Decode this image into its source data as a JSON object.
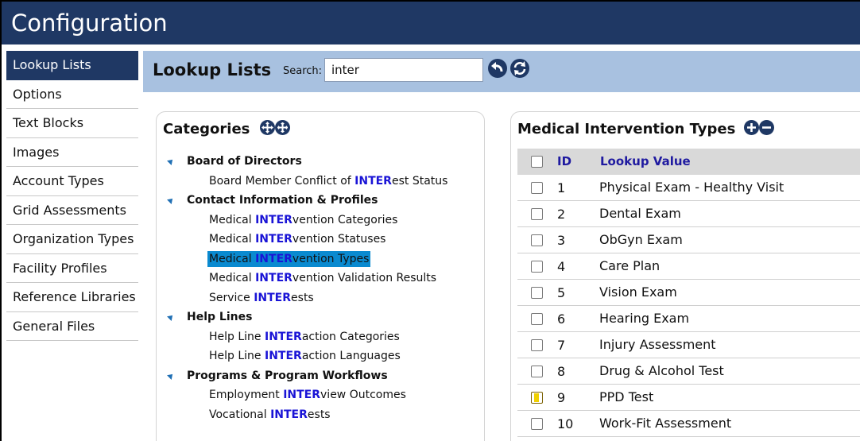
{
  "window": {
    "title": "Configuration"
  },
  "sidebar": {
    "items": [
      {
        "label": "Lookup Lists",
        "active": true
      },
      {
        "label": "Options"
      },
      {
        "label": "Text Blocks"
      },
      {
        "label": "Images"
      },
      {
        "label": "Account Types"
      },
      {
        "label": "Grid Assessments"
      },
      {
        "label": "Organization Types"
      },
      {
        "label": "Facility Profiles"
      },
      {
        "label": "Reference Libraries"
      },
      {
        "label": "General Files"
      }
    ]
  },
  "header": {
    "title": "Lookup Lists",
    "search_label": "Search:",
    "search_value": "inter",
    "buttons": [
      {
        "name": "undo-icon"
      },
      {
        "name": "refresh-icon"
      }
    ]
  },
  "categories": {
    "title": "Categories",
    "icons": [
      "expand-all-icon",
      "collapse-all-icon"
    ],
    "groups": [
      {
        "label": "Board of Directors",
        "children": [
          {
            "pre": "Board Member Conflict of ",
            "hl": "INTER",
            "post": "est Status"
          }
        ]
      },
      {
        "label": "Contact Information & Profiles",
        "children": [
          {
            "pre": "Medical ",
            "hl": "INTER",
            "post": "vention Categories"
          },
          {
            "pre": "Medical ",
            "hl": "INTER",
            "post": "vention Statuses"
          },
          {
            "pre": "Medical ",
            "hl": "INTER",
            "post": "vention Types",
            "selected": true
          },
          {
            "pre": "Medical ",
            "hl": "INTER",
            "post": "vention Validation Results"
          },
          {
            "pre": "Service ",
            "hl": "INTER",
            "post": "ests"
          }
        ]
      },
      {
        "label": "Help Lines",
        "children": [
          {
            "pre": "Help Line ",
            "hl": "INTER",
            "post": "action Categories"
          },
          {
            "pre": "Help Line ",
            "hl": "INTER",
            "post": "action Languages"
          }
        ]
      },
      {
        "label": "Programs & Program Workflows",
        "children": [
          {
            "pre": "Employment ",
            "hl": "INTER",
            "post": "view Outcomes"
          },
          {
            "pre": "Vocational ",
            "hl": "INTER",
            "post": "ests"
          }
        ]
      }
    ]
  },
  "lookup": {
    "title": "Medical Intervention Types",
    "icons": [
      "add-icon",
      "remove-icon"
    ],
    "columns": {
      "id": "ID",
      "value": "Lookup Value"
    },
    "rows": [
      {
        "id": "1",
        "value": "Physical Exam - Healthy Visit"
      },
      {
        "id": "2",
        "value": "Dental Exam"
      },
      {
        "id": "3",
        "value": "ObGyn Exam"
      },
      {
        "id": "4",
        "value": "Care Plan"
      },
      {
        "id": "5",
        "value": "Vision Exam"
      },
      {
        "id": "6",
        "value": "Hearing Exam"
      },
      {
        "id": "7",
        "value": "Injury Assessment"
      },
      {
        "id": "8",
        "value": "Drug & Alcohol Test"
      },
      {
        "id": "9",
        "value": "PPD Test",
        "highlight": true
      },
      {
        "id": "10",
        "value": "Work-Fit Assessment"
      }
    ]
  },
  "colors": {
    "titlebar": "#1f3864",
    "header_band": "#a8c1e0",
    "highlight_text": "#1a14d6",
    "selection": "#0a8ad0"
  }
}
